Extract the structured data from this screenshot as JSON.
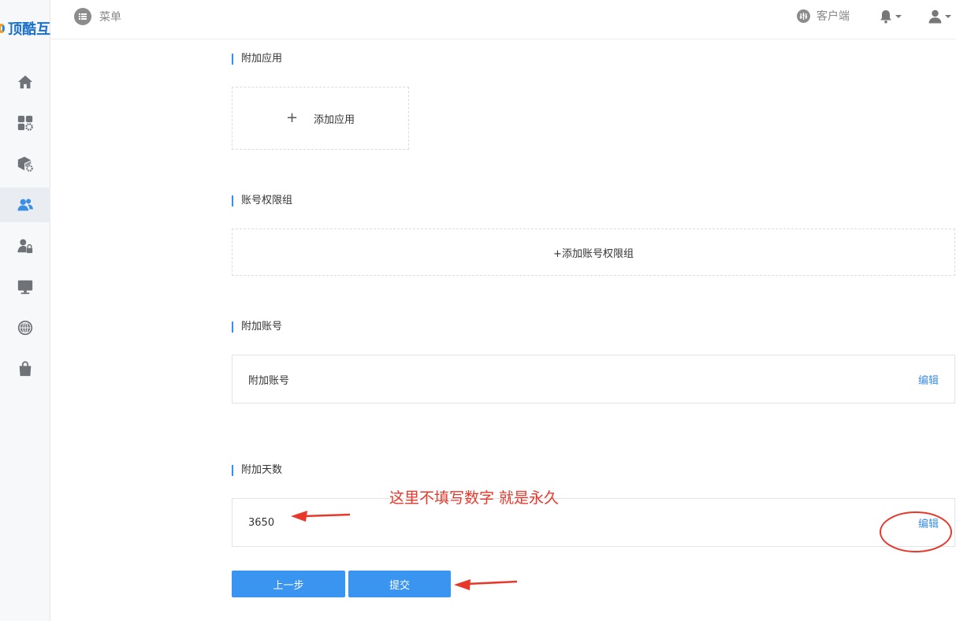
{
  "brand": {
    "logo_text": "顶酷互"
  },
  "sidebar": {
    "items": [
      {
        "icon": "home-icon"
      },
      {
        "icon": "apps-settings-icon"
      },
      {
        "icon": "package-settings-icon"
      },
      {
        "icon": "users-icon",
        "active": true
      },
      {
        "icon": "user-lock-icon"
      },
      {
        "icon": "monitor-icon"
      },
      {
        "icon": "globe-icon"
      },
      {
        "icon": "shopping-bag-icon"
      }
    ]
  },
  "header": {
    "menu_label": "菜单",
    "client_label": "客户端"
  },
  "sections": {
    "apps": {
      "title": "附加应用",
      "add_label": "添加应用"
    },
    "groups": {
      "title": "账号权限组",
      "add_label": "+添加账号权限组"
    },
    "accounts": {
      "title": "附加账号",
      "value": "附加账号",
      "edit_label": "编辑"
    },
    "days": {
      "title": "附加天数",
      "value": "3650",
      "edit_label": "编辑"
    }
  },
  "buttons": {
    "prev_label": "上一步",
    "submit_label": "提交"
  },
  "annotation": {
    "text": "这里不填写数字 就是永久"
  },
  "colors": {
    "accent": "#3a8ee6",
    "button": "#3a95f0",
    "annotation": "#e8382b"
  }
}
